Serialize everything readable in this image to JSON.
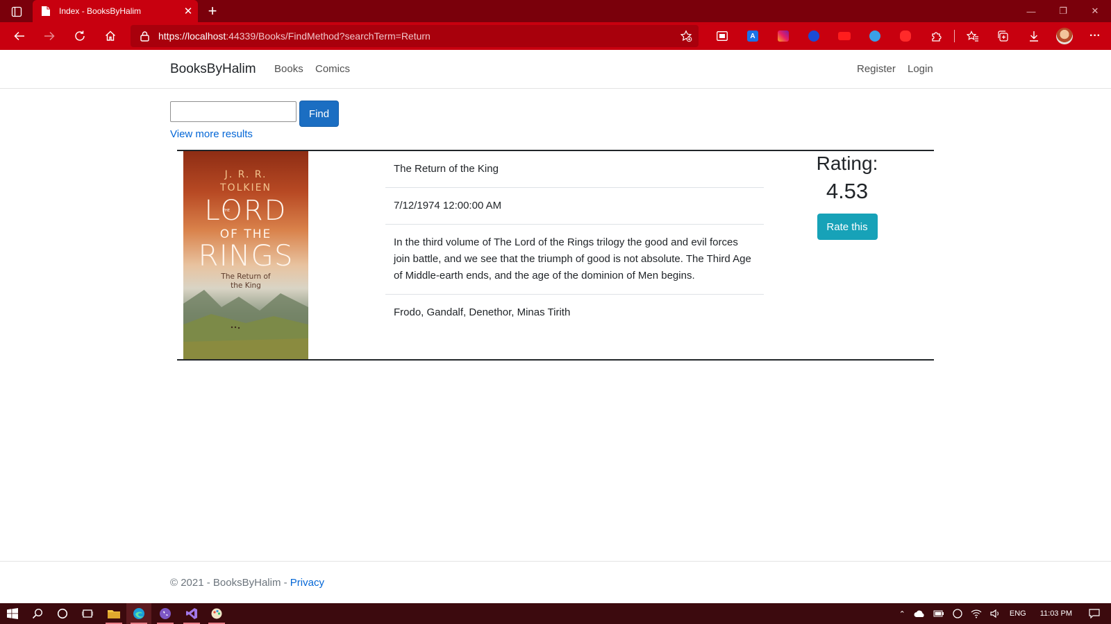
{
  "browser": {
    "tab_title": "Index - BooksByHalim",
    "url_prefix": "https://localhost",
    "url_rest": ":44339/Books/FindMethod?searchTerm=Return",
    "tab_close": "✕",
    "new_tab": "+",
    "minimize": "—",
    "restore": "❐",
    "close": "✕",
    "more": "···",
    "accent_color": "#c8000f"
  },
  "nav": {
    "brand": "BooksByHalim",
    "links": [
      "Books",
      "Comics"
    ],
    "register": "Register",
    "login": "Login"
  },
  "search": {
    "value": "",
    "button": "Find",
    "more_link": "View more results"
  },
  "book": {
    "cover": {
      "author": "J. R. R.\nTOLKIEN",
      "title_line1": "LORD",
      "title_the": "THE",
      "title_line2": "OF THE",
      "title_line3": "RINGS",
      "subtitle": "The Return of\nthe King"
    },
    "title": "The Return of the King",
    "date": "7/12/1974 12:00:00 AM",
    "description": "In the third volume of The Lord of the Rings trilogy the good and evil forces join battle, and we see that the triumph of good is not absolute. The Third Age of Middle-earth ends, and the age of the dominion of Men begins.",
    "characters": "Frodo, Gandalf, Denethor, Minas Tirith",
    "rating_label": "Rating:",
    "rating_value": "4.53",
    "rate_button": "Rate this"
  },
  "footer": {
    "copyright": "© 2021 - BooksByHalim - ",
    "privacy": "Privacy"
  },
  "taskbar": {
    "language": "ENG",
    "time": "11:03 PM"
  }
}
